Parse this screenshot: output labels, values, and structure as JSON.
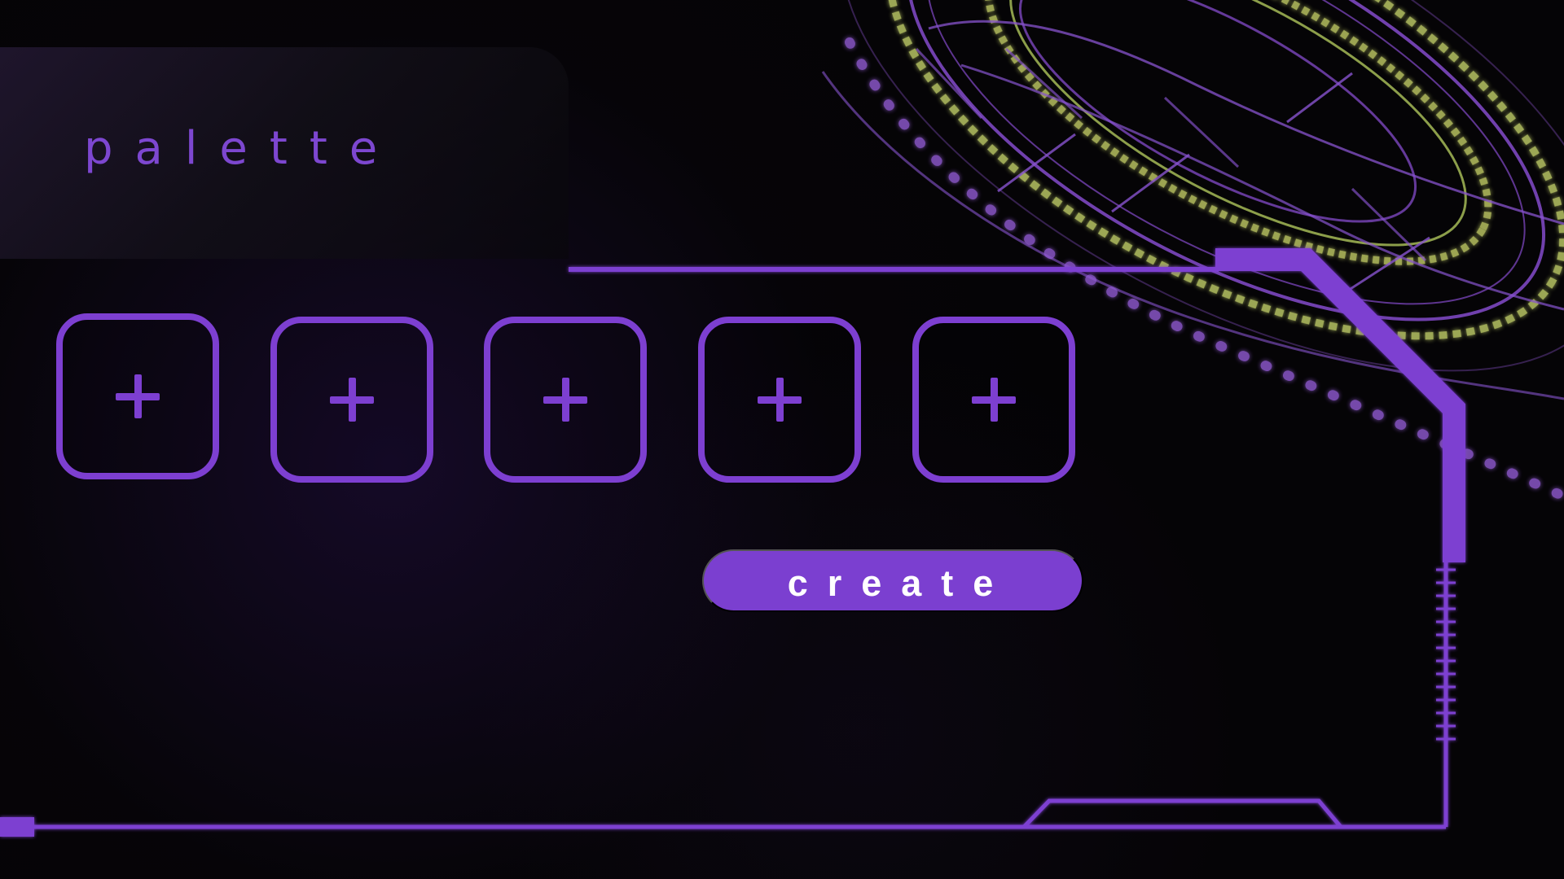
{
  "app": {
    "title": "palette"
  },
  "palette": {
    "slots": [
      {
        "label": "+",
        "icon": "plus-icon"
      },
      {
        "label": "+",
        "icon": "plus-icon"
      },
      {
        "label": "+",
        "icon": "plus-icon"
      },
      {
        "label": "+",
        "icon": "plus-icon"
      },
      {
        "label": "+",
        "icon": "plus-icon"
      }
    ]
  },
  "actions": {
    "create_label": "create"
  },
  "theme": {
    "accent": "#7D3FD1",
    "button": "#7B3FD0",
    "hud_yellow": "#C8D66D",
    "background": "#050406"
  }
}
